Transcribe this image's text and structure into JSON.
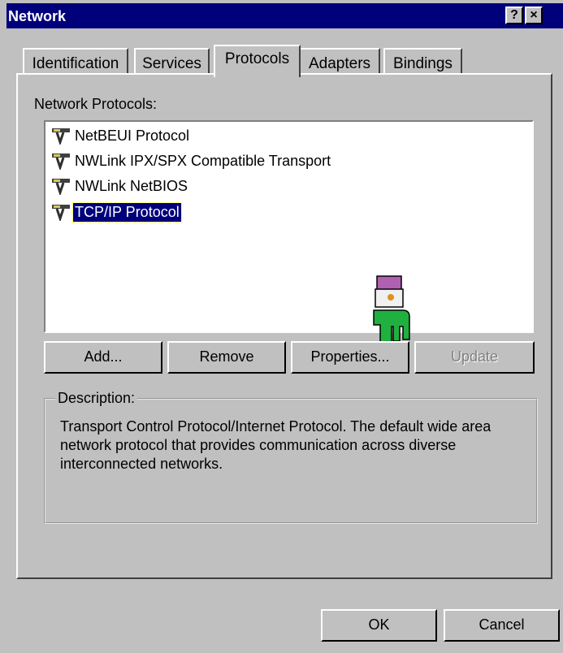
{
  "window": {
    "title": "Network",
    "help_glyph": "?",
    "close_glyph": "×"
  },
  "tabs": [
    {
      "label": "Identification"
    },
    {
      "label": "Services"
    },
    {
      "label": "Protocols"
    },
    {
      "label": "Adapters"
    },
    {
      "label": "Bindings"
    }
  ],
  "protocols": {
    "heading": "Network Protocols:",
    "items": [
      {
        "label": "NetBEUI Protocol"
      },
      {
        "label": "NWLink IPX/SPX Compatible Transport"
      },
      {
        "label": "NWLink NetBIOS"
      },
      {
        "label": "TCP/IP Protocol"
      }
    ],
    "selected_label": "TCP/IP Protocol"
  },
  "actions": {
    "add": "Add...",
    "remove": "Remove",
    "properties": "Properties...",
    "update": "Update"
  },
  "description": {
    "legend": "Description:",
    "text": "Transport Control Protocol/Internet Protocol. The default wide area network protocol that provides communication across diverse interconnected networks."
  },
  "footer": {
    "ok": "OK",
    "cancel": "Cancel"
  },
  "icons": {
    "protocol": "network-protocol-icon",
    "cursor": "hand-pointer-icon"
  },
  "colors": {
    "titlebar": "#00007b",
    "selection": "#00007b",
    "face": "#c0c0c0"
  }
}
